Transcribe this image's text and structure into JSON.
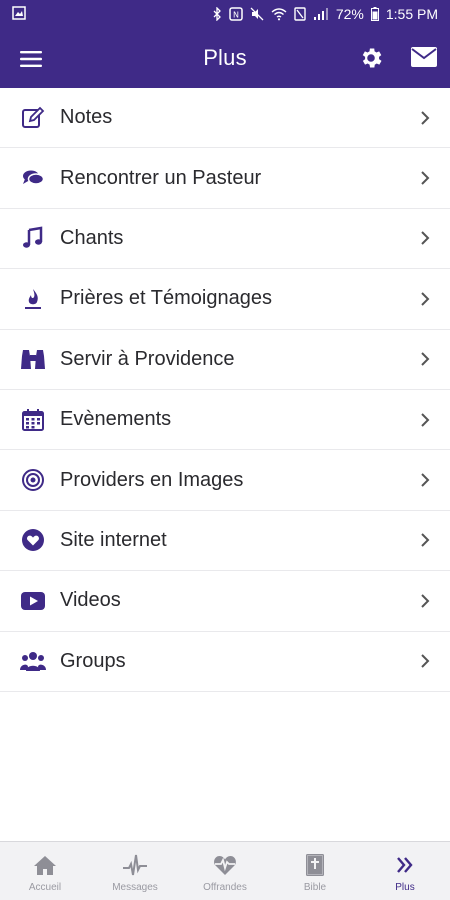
{
  "status_bar": {
    "battery_percent": "72%",
    "time": "1:55 PM"
  },
  "app_bar": {
    "title": "Plus"
  },
  "colors": {
    "primary": "#3f2a87",
    "text": "#2a2a2e",
    "nav_inactive": "#9a9aa2"
  },
  "menu": {
    "items": [
      {
        "label": "Notes",
        "icon": "edit-note-icon"
      },
      {
        "label": "Rencontrer un Pasteur",
        "icon": "chat-bubbles-icon"
      },
      {
        "label": "Chants",
        "icon": "music-note-icon"
      },
      {
        "label": "Prières et Témoignages",
        "icon": "flame-icon"
      },
      {
        "label": "Servir à Providence",
        "icon": "binoculars-icon"
      },
      {
        "label": "Evènements",
        "icon": "calendar-icon"
      },
      {
        "label": "Providers en Images",
        "icon": "target-icon"
      },
      {
        "label": "Site internet",
        "icon": "heart-circle-icon"
      },
      {
        "label": "Videos",
        "icon": "youtube-play-icon"
      },
      {
        "label": "Groups",
        "icon": "users-icon"
      }
    ]
  },
  "bottom_nav": {
    "items": [
      {
        "label": "Accueil",
        "icon": "home-icon",
        "active": false
      },
      {
        "label": "Messages",
        "icon": "pulse-icon",
        "active": false
      },
      {
        "label": "Offrandes",
        "icon": "heart-pulse-icon",
        "active": false
      },
      {
        "label": "Bible",
        "icon": "bible-icon",
        "active": false
      },
      {
        "label": "Plus",
        "icon": "double-chevron-icon",
        "active": true
      }
    ]
  }
}
